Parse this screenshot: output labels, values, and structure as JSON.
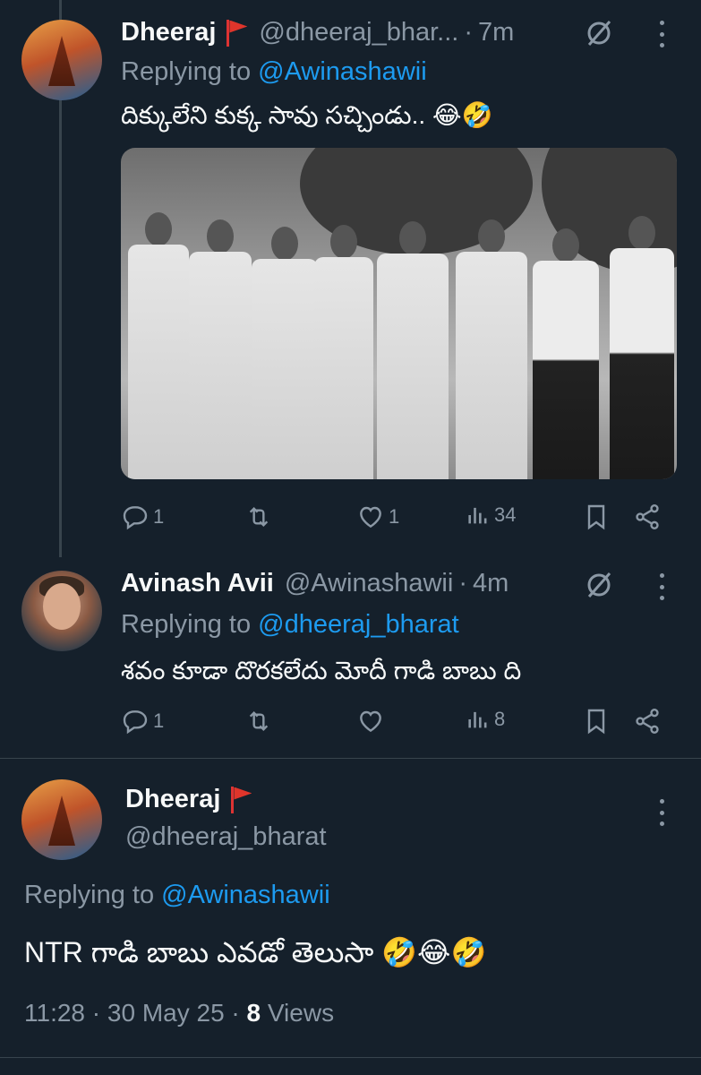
{
  "tweets": [
    {
      "name": "Dheeraj",
      "handle": "@dheeraj_bhar...",
      "sep": "·",
      "time": "7m",
      "replying_prefix": "Replying to ",
      "replying_to": "@Awinashawii",
      "text": "దిక్కులేని కుక్క సావు సచ్చిండు.. 😂🤣",
      "actions": {
        "replies": "1",
        "retweets": "",
        "likes": "1",
        "views": "34"
      }
    },
    {
      "name": "Avinash Avii",
      "handle": "@Awinashawii",
      "sep": "·",
      "time": "4m",
      "replying_prefix": "Replying to ",
      "replying_to": "@dheeraj_bharat",
      "text": "శవం కూడా దొరకలేదు మోదీ గాడి బాబు ది",
      "actions": {
        "replies": "1",
        "retweets": "",
        "likes": "",
        "views": "8"
      }
    }
  ],
  "main_tweet": {
    "name": "Dheeraj",
    "handle": "@dheeraj_bharat",
    "replying_prefix": "Replying to ",
    "replying_to": "@Awinashawii",
    "text": "NTR గాడి బాబు ఎవడో తెలుసా 🤣😂🤣",
    "time": "11:28",
    "sep": "·",
    "date": "30 May 25",
    "views_count": "8",
    "views_label": "Views"
  },
  "colors": {
    "background": "#15202b",
    "primary_text": "#f7f9f9",
    "secondary_text": "#8b98a5",
    "link": "#1d9bf0",
    "border": "#38444d"
  },
  "icons": [
    "reply-icon",
    "retweet-icon",
    "like-icon",
    "views-icon",
    "bookmark-icon",
    "share-icon",
    "grok-icon",
    "more-icon",
    "flag-icon"
  ]
}
